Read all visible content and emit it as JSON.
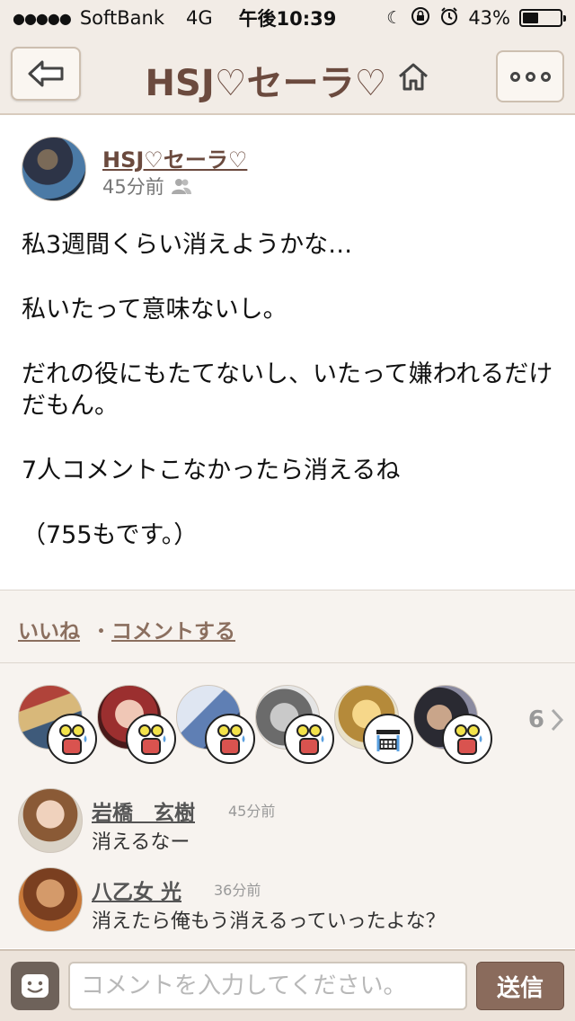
{
  "status_bar": {
    "carrier": "SoftBank",
    "network": "4G",
    "time": "午後10:39",
    "battery_percent": "43%",
    "battery_level": 0.43
  },
  "nav": {
    "title": "HSJ♡セーラ♡",
    "back_icon": "back-arrow-icon",
    "home_icon": "home-icon",
    "more_icon": "more-icon"
  },
  "post": {
    "author": "HSJ♡セーラ♡",
    "time": "45分前",
    "lines": [
      "私3週間くらい消えようかな…",
      "私いたって意味ないし。",
      "だれの役にもたてないし、いたって嫌われるだけだもん。",
      "7人コメントこなかったら消えるね",
      "（755もです。）"
    ]
  },
  "actions": {
    "like": "いいね",
    "separator": "・",
    "comment": "コメントする"
  },
  "likes": {
    "count": "6"
  },
  "comments": [
    {
      "name": "岩橋　玄樹",
      "time": "45分前",
      "text": "消えるなー"
    },
    {
      "name": "八乙女 光",
      "time": "36分前",
      "text": "消えたら俺もう消えるっていったよな？"
    }
  ],
  "input": {
    "placeholder": "コメントを入力してください。",
    "send": "送信"
  },
  "colors": {
    "brand_brown": "#6b4a3e",
    "bar_beige": "#f2ece6",
    "send_button": "#8a6b5c"
  }
}
